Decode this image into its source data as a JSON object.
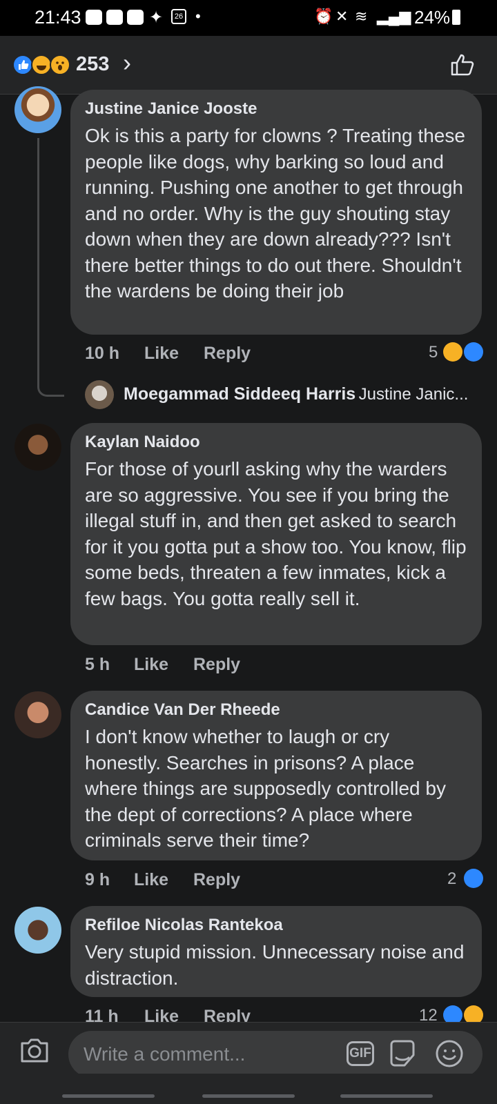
{
  "status": {
    "time": "21:43",
    "calendar_day": "26",
    "battery": "24%",
    "icons": [
      "youtube-icon",
      "youtube-icon",
      "youtube-icon",
      "twitter-icon",
      "calendar-icon",
      "alarm-icon",
      "mute-icon",
      "wifi-icon",
      "signal-icon",
      "battery-icon"
    ]
  },
  "header": {
    "reaction_icons": [
      "like-icon",
      "haha-icon",
      "wow-icon"
    ],
    "reaction_count": "253"
  },
  "comments": [
    {
      "author": "Justine Janice Jooste",
      "text": "Ok is this a party for clowns ? Treating these people like dogs, why barking so loud and running. Pushing one another to get through and no order. Why is the guy shouting stay down when they are down already??? Isn't there better things to do out there. Shouldn't the wardens be doing their job",
      "time": "10 h",
      "like": "Like",
      "reply": "Reply",
      "reactions": "5",
      "reply_preview": {
        "author": "Moegammad Siddeeq Harris",
        "mention": "Justine Janic..."
      }
    },
    {
      "author": "Kaylan Naidoo",
      "text": "For those of yourll asking why the warders are so aggressive. You see if you bring the illegal stuff in, and then get asked to search for it you gotta put a show too. You know, flip some beds, threaten a few inmates, kick a few bags. You gotta really sell it.",
      "time": "5 h",
      "like": "Like",
      "reply": "Reply"
    },
    {
      "author": "Candice Van Der Rheede",
      "text": "I don't know whether to laugh or cry honestly. Searches in prisons? A place where things are supposedly controlled by the dept of corrections? A place where criminals serve their time?",
      "time": "9 h",
      "like": "Like",
      "reply": "Reply",
      "reactions": "2"
    },
    {
      "author": "Refiloe Nicolas Rantekoa",
      "text": "Very stupid mission. Unnecessary noise and distraction.",
      "time": "11 h",
      "like": "Like",
      "reply": "Reply",
      "reactions": "12"
    }
  ],
  "composer": {
    "placeholder": "Write a comment...",
    "gif_label": "GIF"
  },
  "colors": {
    "background": "#18191a",
    "bubble": "#3a3b3c",
    "like_blue": "#2d88ff",
    "haha_yellow": "#f7b125"
  }
}
